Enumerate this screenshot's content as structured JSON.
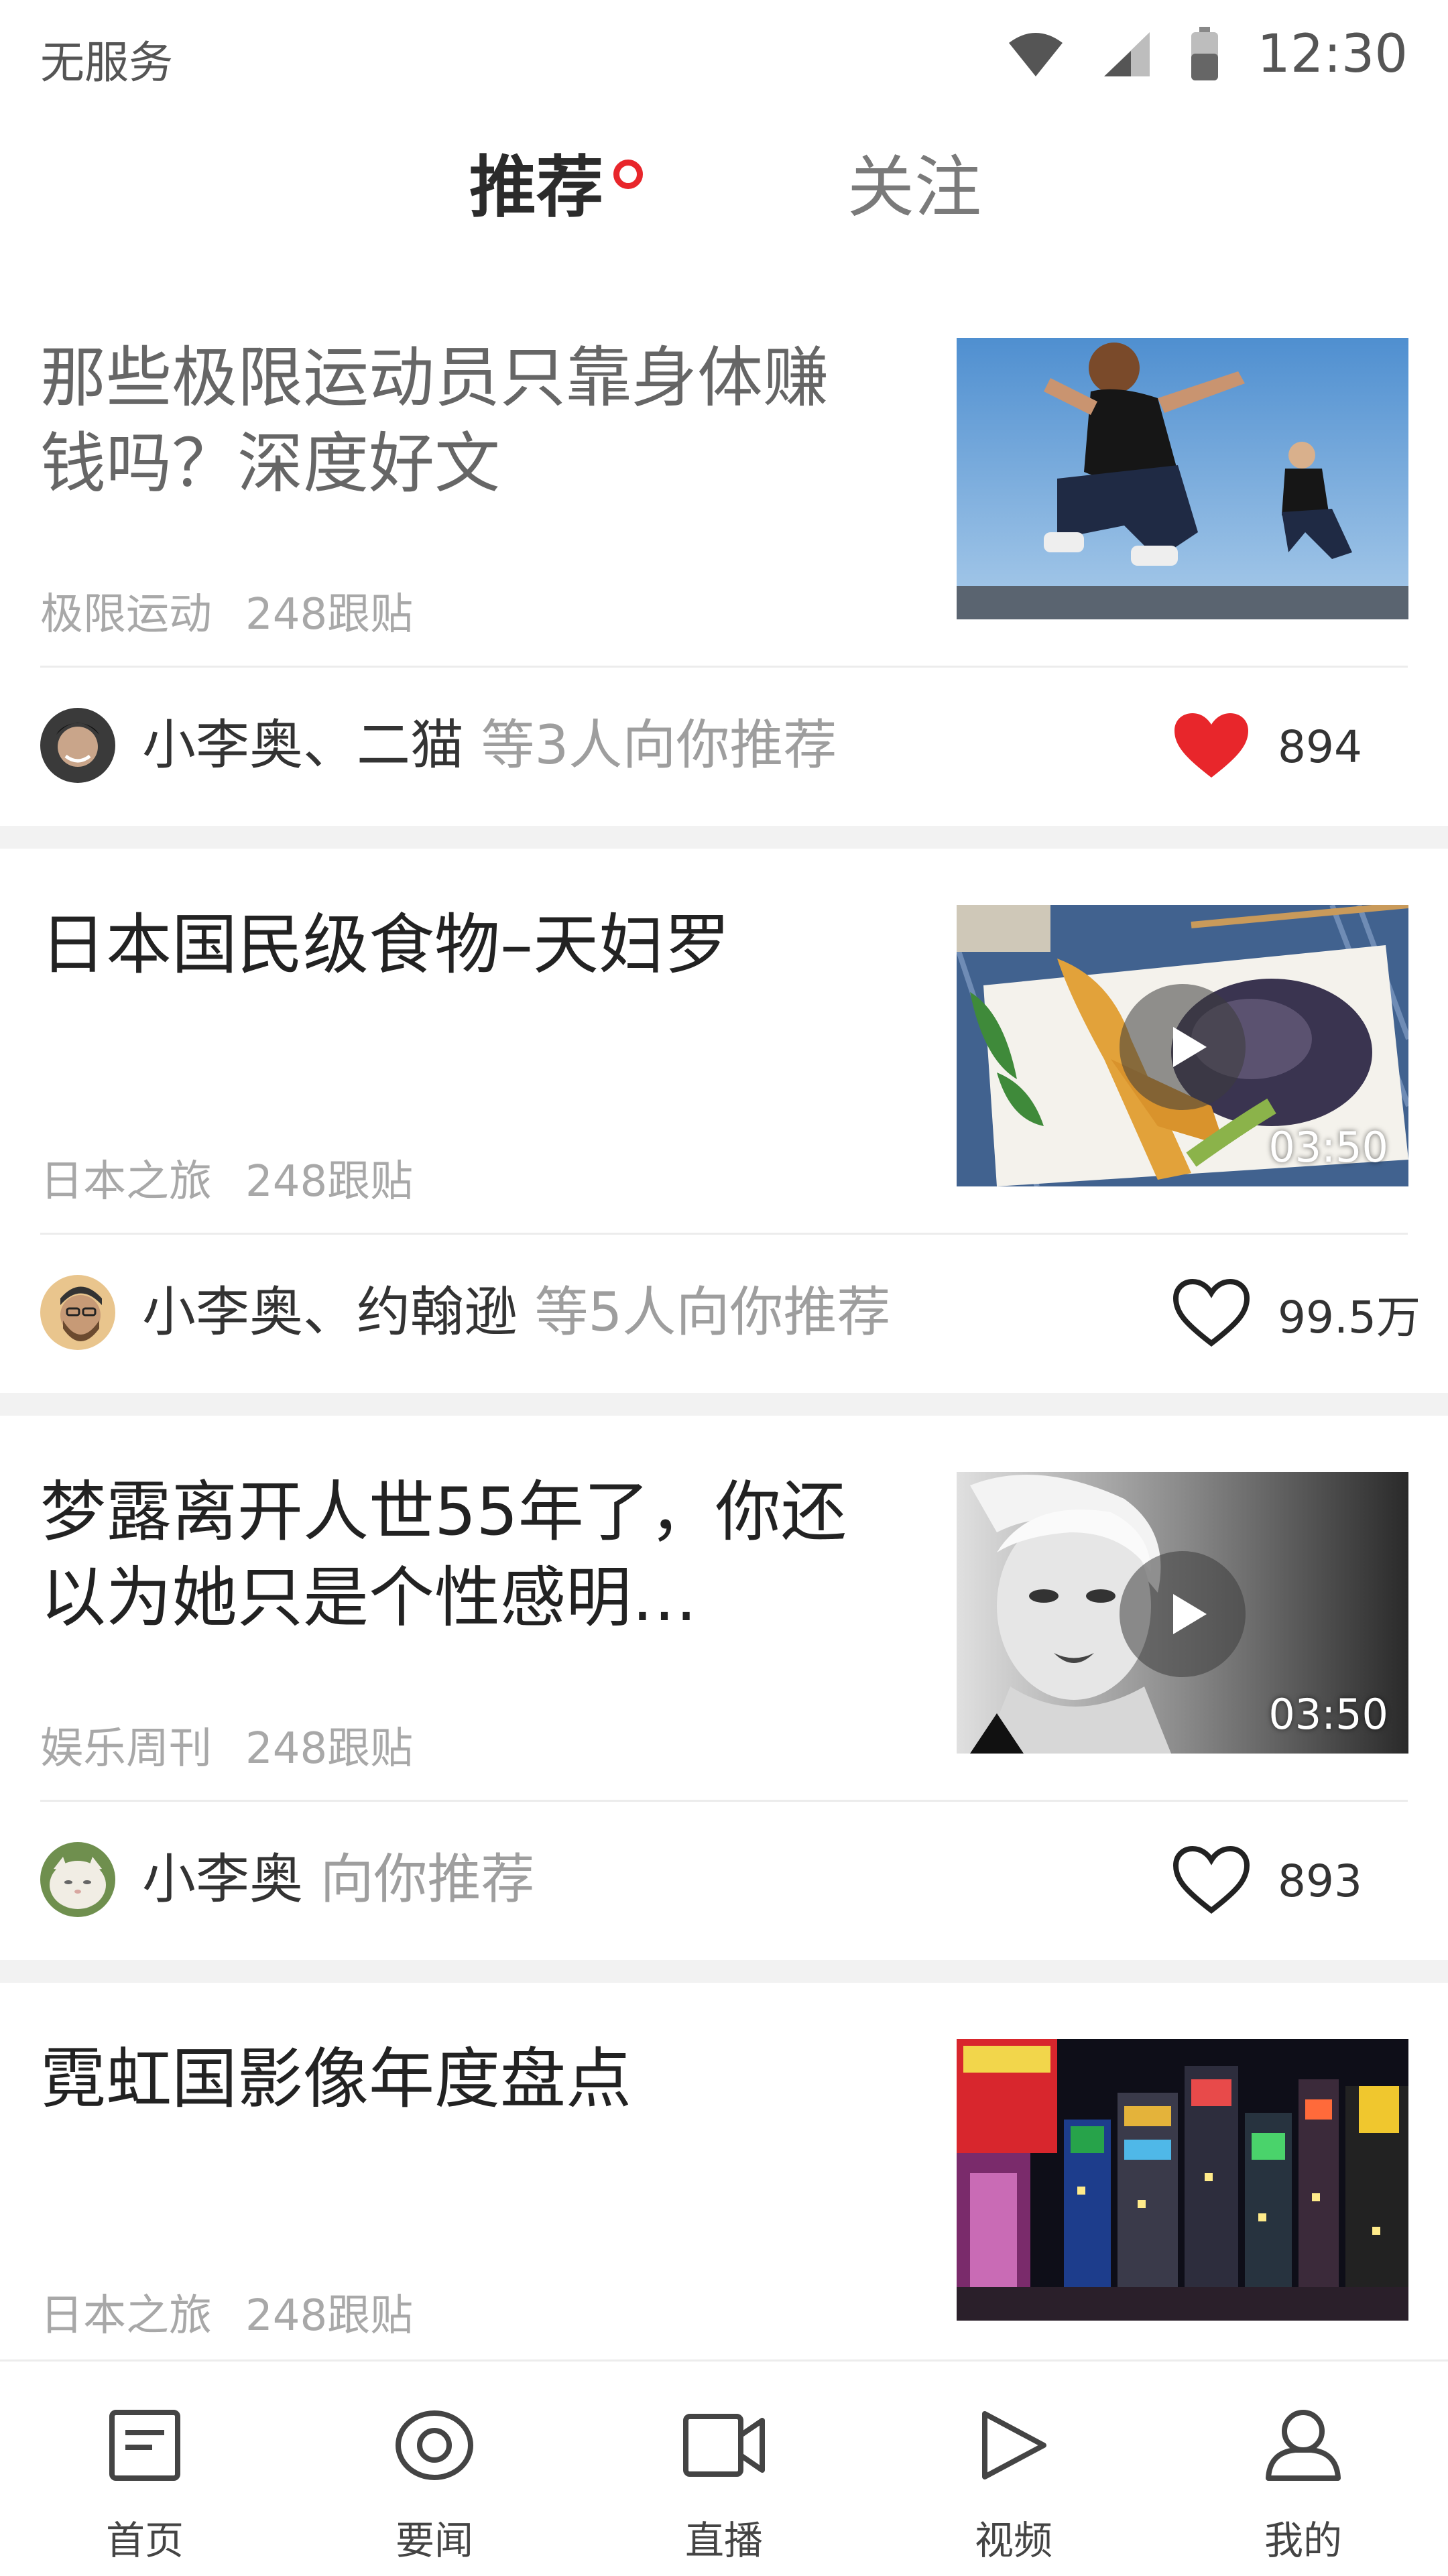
{
  "status_bar": {
    "carrier": "无服务",
    "time": "12:30"
  },
  "tabs": [
    {
      "label": "推荐",
      "active": true
    },
    {
      "label": "关注",
      "active": false
    }
  ],
  "colors": {
    "accent": "#e8262b",
    "muted_text": "#a8a8a8",
    "divider": "#ececec"
  },
  "feed": [
    {
      "title": "那些极限运动员只靠身体赚钱吗？深度好文",
      "source": "极限运动",
      "replies": "248跟贴",
      "has_video": false,
      "recommenders": "小李奥、二猫",
      "recommend_suffix": "等3人向你推荐",
      "likes": "894",
      "liked": true
    },
    {
      "title": "日本国民级食物–天妇罗",
      "source": "日本之旅",
      "replies": "248跟贴",
      "has_video": true,
      "duration": "03:50",
      "recommenders": "小李奥、约翰逊",
      "recommend_suffix": "等5人向你推荐",
      "likes": "99.5万",
      "liked": false
    },
    {
      "title": "梦露离开人世55年了，你还以为她只是个性感明…",
      "source": "娱乐周刊",
      "replies": "248跟贴",
      "has_video": true,
      "duration": "03:50",
      "recommenders": "小李奥",
      "recommend_suffix": "向你推荐",
      "likes": "893",
      "liked": false
    },
    {
      "title": "霓虹国影像年度盘点",
      "source": "日本之旅",
      "replies": "248跟贴",
      "has_video": false
    }
  ],
  "bottom_nav": [
    {
      "label": "首页",
      "icon": "document-icon"
    },
    {
      "label": "要闻",
      "icon": "eye-icon"
    },
    {
      "label": "直播",
      "icon": "camera-icon"
    },
    {
      "label": "视频",
      "icon": "play-icon"
    },
    {
      "label": "我的",
      "icon": "user-icon"
    }
  ]
}
